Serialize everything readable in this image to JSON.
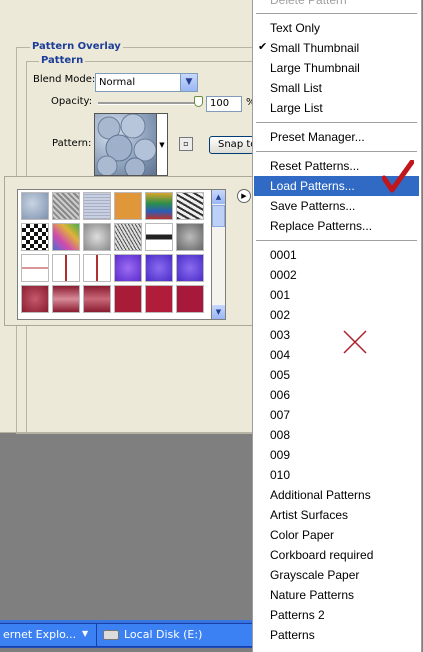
{
  "dialog": {
    "group_outer_title": "Pattern Overlay",
    "group_inner_title": "Pattern",
    "blend_mode_label": "Blend Mode:",
    "blend_mode_value": "Normal",
    "opacity_label": "Opacity:",
    "opacity_value": "100",
    "opacity_unit": "%",
    "opacity_fraction": 1.0,
    "pattern_label": "Pattern:",
    "snap_button": "Snap to"
  },
  "picker": {
    "tile_count_visible": 24
  },
  "taskbar": {
    "ie_label": "ernet Explo...",
    "disk_label": "Local Disk (E:)"
  },
  "menu": {
    "top_item": "Delete Pattern",
    "view_items": [
      {
        "label": "Text Only",
        "checked": false
      },
      {
        "label": "Small Thumbnail",
        "checked": true
      },
      {
        "label": "Large Thumbnail",
        "checked": false
      },
      {
        "label": "Small List",
        "checked": false
      },
      {
        "label": "Large List",
        "checked": false
      }
    ],
    "preset_manager": "Preset Manager...",
    "actions": [
      "Reset Patterns...",
      "Load Patterns...",
      "Save Patterns...",
      "Replace Patterns..."
    ],
    "highlighted": "Load Patterns...",
    "libraries": [
      "0001",
      "0002",
      "001",
      "002",
      "003",
      "004",
      "005",
      "006",
      "007",
      "008",
      "009",
      "010",
      "Additional Patterns",
      "Artist Surfaces",
      "Color Paper",
      "Corkboard required",
      "Grayscale Paper",
      "Nature Patterns",
      "Patterns 2",
      "Patterns"
    ]
  },
  "colors": {
    "menu_highlight": "#316ac5",
    "annotation_red": "#c0161c",
    "group_title": "#1c3d99"
  },
  "icons": [
    "checkmark-icon",
    "chevron-down-icon",
    "flyout-arrow-icon",
    "new-preset-icon",
    "disk-icon",
    "red-check-icon",
    "red-x-icon"
  ]
}
